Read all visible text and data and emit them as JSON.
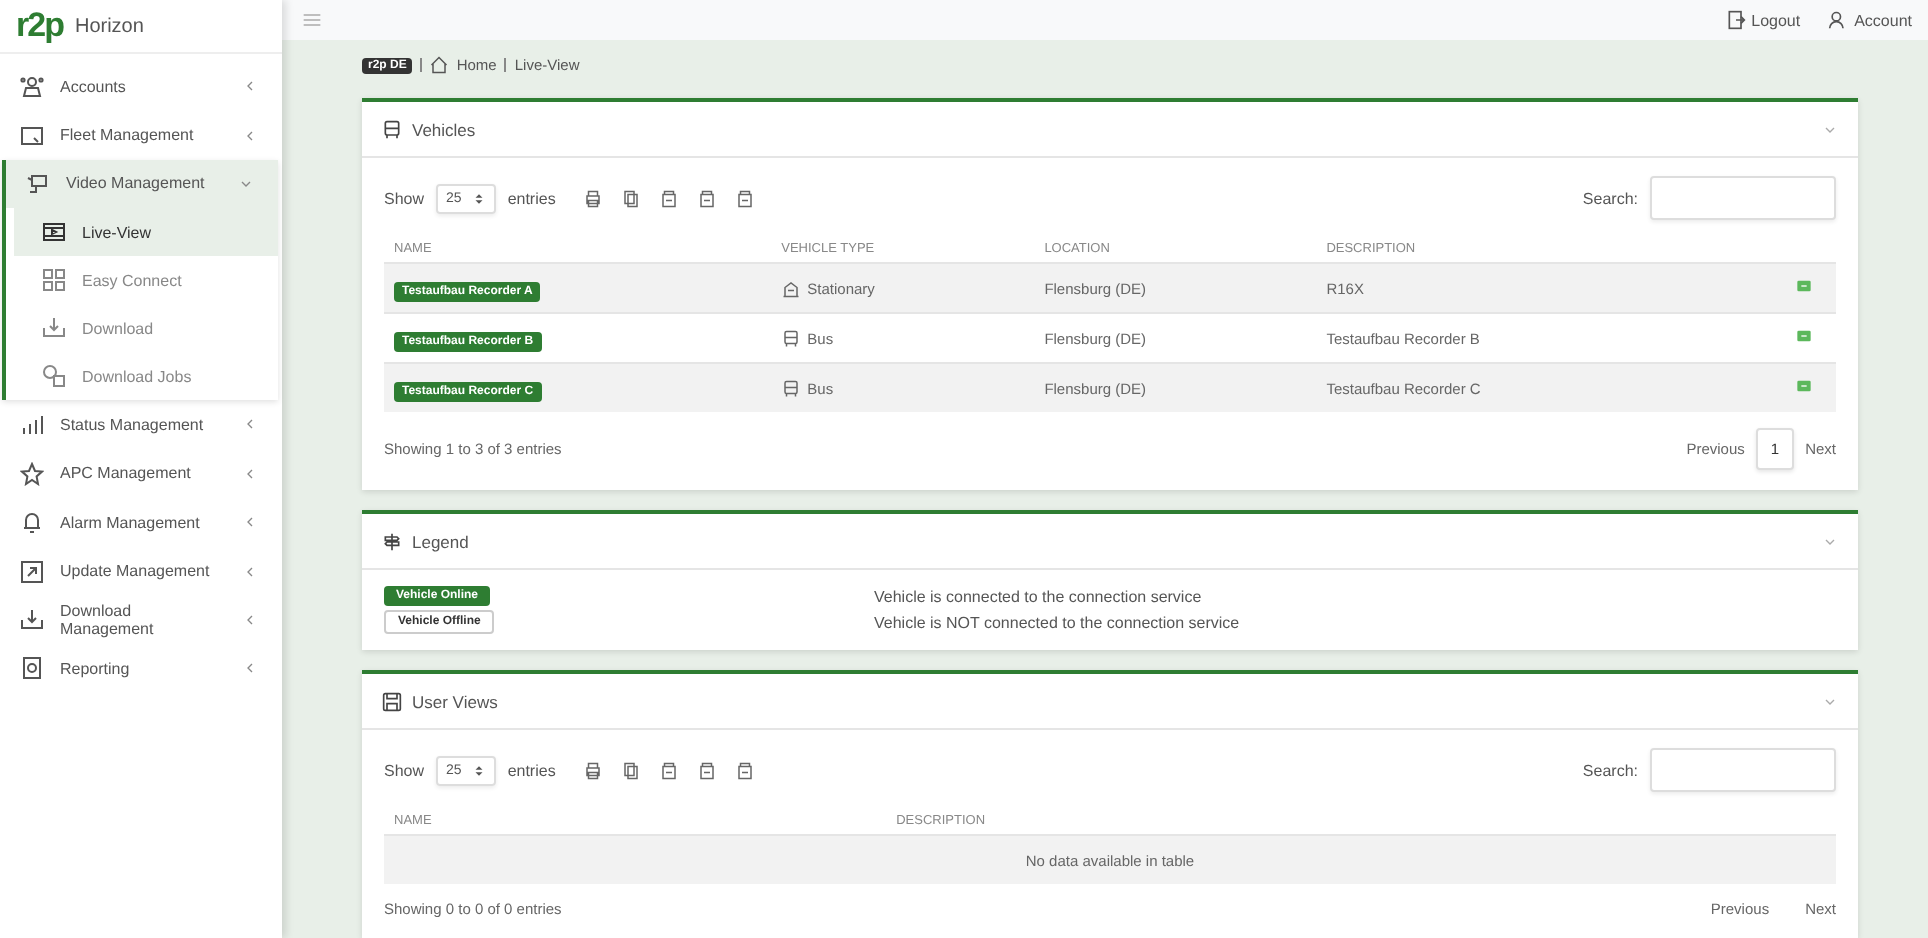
{
  "brand": {
    "logo": "r2p",
    "name": "Horizon"
  },
  "sidebar": {
    "items": [
      {
        "label": "Accounts",
        "expanded": false
      },
      {
        "label": "Fleet Management",
        "expanded": false
      },
      {
        "label": "Video Management",
        "expanded": true,
        "children": [
          {
            "label": "Live-View",
            "selected": true
          },
          {
            "label": "Easy Connect",
            "selected": false
          },
          {
            "label": "Download",
            "selected": false
          },
          {
            "label": "Download Jobs",
            "selected": false
          }
        ]
      },
      {
        "label": "Status Management",
        "expanded": false
      },
      {
        "label": "APC Management",
        "expanded": false
      },
      {
        "label": "Alarm Management",
        "expanded": false
      },
      {
        "label": "Update Management",
        "expanded": false
      },
      {
        "label": "Download Management",
        "expanded": false
      },
      {
        "label": "Reporting",
        "expanded": false
      }
    ]
  },
  "header": {
    "logout": "Logout",
    "account": "Account"
  },
  "breadcrumb": {
    "tag": "r2p DE",
    "items": [
      "Home",
      "Live-View"
    ]
  },
  "vehicles": {
    "title": "Vehicles",
    "show": "Show",
    "page_size": "25",
    "entries": "entries",
    "search_label": "Search:",
    "columns": [
      "NAME",
      "VEHICLE TYPE",
      "LOCATION",
      "DESCRIPTION"
    ],
    "rows": [
      {
        "name": "Testaufbau Recorder A",
        "online": true,
        "type": "Stationary",
        "kind": "stationary",
        "location": "Flensburg (DE)",
        "description": "R16X"
      },
      {
        "name": "Testaufbau Recorder B",
        "online": true,
        "type": "Bus",
        "kind": "bus",
        "location": "Flensburg (DE)",
        "description": "Testaufbau Recorder B"
      },
      {
        "name": "Testaufbau Recorder C",
        "online": true,
        "type": "Bus",
        "kind": "bus",
        "location": "Flensburg (DE)",
        "description": "Testaufbau Recorder C"
      }
    ],
    "info": "Showing 1 to 3 of 3 entries",
    "previous": "Previous",
    "pages": [
      {
        "label": "1",
        "selected": true
      }
    ],
    "next": "Next"
  },
  "legend": {
    "title": "Legend",
    "items": [
      {
        "kind": "online",
        "label": "Vehicle Online",
        "text": "Vehicle is connected to the connection service"
      },
      {
        "kind": "offline",
        "label": "Vehicle Offline",
        "text": "Vehicle is NOT connected to the connection service"
      }
    ]
  },
  "user_views": {
    "title": "User Views",
    "show": "Show",
    "page_size": "25",
    "entries": "entries",
    "search_label": "Search:",
    "columns": [
      "NAME",
      "DESCRIPTION"
    ],
    "empty": "No data available in table",
    "info": "Showing 0 to 0 of 0 entries",
    "previous": "Previous",
    "next": "Next"
  }
}
